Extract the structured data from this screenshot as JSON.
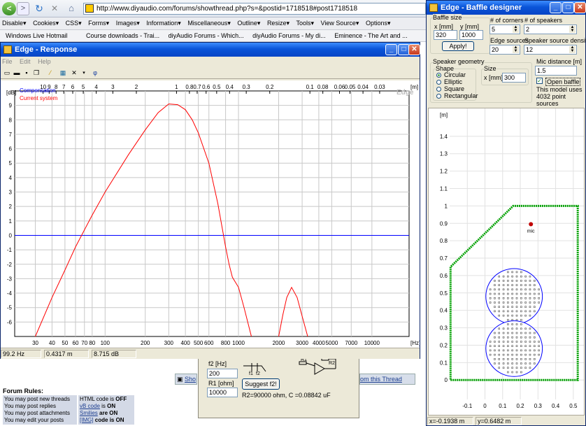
{
  "browser": {
    "back_label": "<",
    "forward_label": ">",
    "refresh_icon": "refresh-icon",
    "stop_label": "✕",
    "home_icon": "home-icon",
    "url": "http://www.diyaudio.com/forums/showthread.php?s=&postid=1718518#post1718518",
    "toolbar_items": [
      "Disable▾",
      "Cookies▾",
      "CSS▾",
      "Forms▾",
      "Images▾",
      "Information▾",
      "Miscellaneous▾",
      "Outline▾",
      "Resize▾",
      "Tools▾",
      "View Source▾",
      "Options▾"
    ],
    "bookmarks": [
      "Windows Live Hotmail",
      "Course downloads - Trai...",
      "diyAudio Forums - Which...",
      "diyAudio Forums - My di...",
      "Eminence - The Art and ..."
    ]
  },
  "response_window": {
    "title": "Edge - Response",
    "menu": [
      "File",
      "Edit",
      "Help"
    ],
    "watermark": "Edge",
    "legend": [
      {
        "label": "Compensation",
        "color": "#0000ff"
      },
      {
        "label": "Current system",
        "color": "#ff0000"
      }
    ],
    "status": [
      "99.2 Hz",
      "0.4317 m",
      "8.715 dB"
    ]
  },
  "chart_data": [
    {
      "type": "line",
      "title": "",
      "xlabel": "[Hz]",
      "ylabel": "[dB]",
      "x_scale": "log",
      "xlim": [
        21,
        19000
      ],
      "ylim": [
        -7,
        10
      ],
      "x_ticks": [
        30,
        40,
        50,
        60,
        70,
        80,
        100,
        200,
        300,
        400,
        500,
        600,
        800,
        1000,
        2000,
        3000,
        4000,
        5000,
        7000,
        10000
      ],
      "y_ticks": [
        9,
        8,
        7,
        6,
        5,
        4,
        3,
        2,
        1,
        0,
        -1,
        -2,
        -3,
        -4,
        -5,
        -6
      ],
      "top_axis_unit": "[m]",
      "top_axis_ticks": [
        {
          "label": "10",
          "hz": 34.3
        },
        {
          "label": "9",
          "hz": 38.1
        },
        {
          "label": "8",
          "hz": 42.9
        },
        {
          "label": "7",
          "hz": 49
        },
        {
          "label": "6",
          "hz": 57.2
        },
        {
          "label": "5",
          "hz": 68.6
        },
        {
          "label": "4",
          "hz": 85.8
        },
        {
          "label": "3",
          "hz": 114.3
        },
        {
          "label": "2",
          "hz": 171.5
        },
        {
          "label": "1",
          "hz": 343
        },
        {
          "label": "0.8",
          "hz": 428.8
        },
        {
          "label": "0.7",
          "hz": 490
        },
        {
          "label": "0.6",
          "hz": 571.7
        },
        {
          "label": "0.5",
          "hz": 686
        },
        {
          "label": "0.4",
          "hz": 857.5
        },
        {
          "label": "0.3",
          "hz": 1143
        },
        {
          "label": "0.2",
          "hz": 1715
        },
        {
          "label": "0.1",
          "hz": 3430
        },
        {
          "label": "0.08",
          "hz": 4288
        },
        {
          "label": "0.06",
          "hz": 5717
        },
        {
          "label": "0.05",
          "hz": 6860
        },
        {
          "label": "0.04",
          "hz": 8575
        },
        {
          "label": "0.03",
          "hz": 11433
        }
      ],
      "series": [
        {
          "name": "Compensation",
          "color": "#0000ff",
          "points": [
            [
              21,
              0
            ],
            [
              19000,
              0
            ]
          ]
        },
        {
          "name": "Current system",
          "color": "#ff0000",
          "points": [
            [
              30,
              -7
            ],
            [
              40,
              -4.3
            ],
            [
              50,
              -2.4
            ],
            [
              60,
              -0.8
            ],
            [
              80,
              1.4
            ],
            [
              100,
              3
            ],
            [
              150,
              5.6
            ],
            [
              200,
              7.3
            ],
            [
              250,
              8.5
            ],
            [
              300,
              9.1
            ],
            [
              350,
              9.05
            ],
            [
              400,
              8.7
            ],
            [
              450,
              8
            ],
            [
              500,
              7.1
            ],
            [
              600,
              5
            ],
            [
              700,
              2.2
            ],
            [
              800,
              -0.8
            ],
            [
              850,
              -2
            ],
            [
              900,
              -2.9
            ],
            [
              1000,
              -3.6
            ],
            [
              1100,
              -5
            ],
            [
              1250,
              -7
            ]
          ]
        },
        {
          "name": "Current system",
          "color": "#ff0000",
          "points": [
            [
              2000,
              -7
            ],
            [
              2150,
              -5.5
            ],
            [
              2300,
              -4.3
            ],
            [
              2500,
              -3.6
            ],
            [
              2750,
              -4.3
            ],
            [
              3000,
              -5.6
            ],
            [
              3300,
              -7
            ]
          ]
        }
      ]
    },
    {
      "type": "scatter",
      "title": "",
      "xlabel": "",
      "ylabel": "[m]",
      "xlim": [
        -0.2,
        0.56
      ],
      "ylim": [
        -0.2,
        1.56
      ],
      "x_ticks": [
        -0.1,
        0,
        0.1,
        0.2,
        0.3,
        0.4,
        0.5
      ],
      "y_ticks": [
        0,
        0.1,
        0.2,
        0.3,
        0.4,
        0.5,
        0.6,
        0.7,
        0.8,
        0.9,
        1,
        1.1,
        1.2,
        1.3,
        1.4
      ],
      "series": [
        {
          "name": "baffle outline",
          "color": "#00a000",
          "points": [
            [
              -0.195,
              0
            ],
            [
              0.525,
              0
            ],
            [
              0.525,
              1
            ],
            [
              0.16,
              1
            ],
            [
              -0.195,
              0.65
            ],
            [
              -0.195,
              0
            ]
          ]
        },
        {
          "name": "speaker 1",
          "color": "#0000ff",
          "center": [
            0.165,
            0.48
          ],
          "radius": 0.16
        },
        {
          "name": "speaker 2",
          "color": "#0000ff",
          "center": [
            0.165,
            0.18
          ],
          "radius": 0.16
        },
        {
          "name": "mic",
          "color": "#c00000",
          "point": [
            0.26,
            0.895
          ]
        }
      ]
    }
  ],
  "filter_dialog": {
    "f2_label": "f2 [Hz]",
    "f2_value": "200",
    "r1_label": "R1 [ohm]",
    "r1_value": "10000",
    "suggest_label": "Suggest f2!",
    "result": "R2=90000 ohm, C =0.08842 uF",
    "f1_label": "f1",
    "f2_short": "f2",
    "r1_short": "R1",
    "r2_short": "R2"
  },
  "forum": {
    "rules_title": "Forum Rules:",
    "rules": [
      "You may post new threads",
      "You may post replies",
      "You may post attachments",
      "You may edit your posts"
    ],
    "codes": [
      {
        "name": "HTML code",
        "state": "OFF"
      },
      {
        "name": "vB code",
        "state": "ON"
      },
      {
        "name": "Smilies",
        "state": "are ON"
      },
      {
        "name": "[IMG]",
        "state": "code is ON"
      }
    ],
    "show_link": "Sho",
    "thread_link": "om this Thread"
  },
  "baffle_designer": {
    "title": "Edge - Baffle designer",
    "baffle_size_label": "Baffle size",
    "x_label": "x [mm]",
    "y_label": "y [mm]",
    "x_value": "320",
    "y_value": "1000",
    "apply_label": "Apply!",
    "corners_label": "# of corners",
    "corners_value": "5",
    "speakers_label": "# of speakers",
    "speakers_value": "2",
    "edge_sources_label": "Edge sources",
    "edge_sources_value": "20",
    "density_label": "Speaker source density",
    "density_value": "12",
    "geometry_label": "Speaker geometry",
    "shape_label": "Shape",
    "shapes": [
      "Circular",
      "Elliptic",
      "Square",
      "Rectangular"
    ],
    "size_label": "Size",
    "size_x_label": "x [mm]",
    "size_x_value": "300",
    "mic_label": "Mic distance [m]",
    "mic_value": "1.5",
    "open_baffle_label": "Open baffle",
    "open_baffle_checked": true,
    "model_info": "This model uses 4032 point sources",
    "mic_marker": "mic",
    "status_x": "x=-0.1938 m",
    "status_y": "y=0.6482 m"
  }
}
